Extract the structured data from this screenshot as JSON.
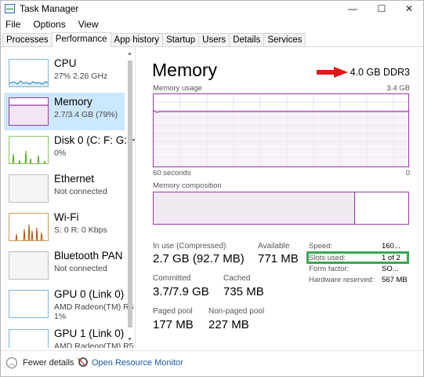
{
  "window": {
    "title": "Task Manager",
    "controls": {
      "minimize": "—",
      "maximize": "☐",
      "close": "✕"
    }
  },
  "menu": [
    "File",
    "Options",
    "View"
  ],
  "tabs": [
    "Processes",
    "Performance",
    "App history",
    "Startup",
    "Users",
    "Details",
    "Services"
  ],
  "active_tab": "Performance",
  "sidebar": {
    "items": [
      {
        "name": "CPU",
        "sub": "27%  2.26 GHz",
        "sub2": "",
        "color": "#117dbb",
        "selected": false
      },
      {
        "name": "Memory",
        "sub": "2.7/3.4 GB (79%)",
        "sub2": "",
        "color": "#8b12ae",
        "selected": true
      },
      {
        "name": "Disk 0 (C: F: G: H",
        "sub": "0%",
        "sub2": "",
        "color": "#4da60c",
        "selected": false
      },
      {
        "name": "Ethernet",
        "sub": "Not connected",
        "sub2": "",
        "color": "#a74f01",
        "selected": false
      },
      {
        "name": "Wi-Fi",
        "sub": "S: 0  R: 0 Kbps",
        "sub2": "",
        "color": "#a74f01",
        "selected": false
      },
      {
        "name": "Bluetooth PAN",
        "sub": "Not connected",
        "sub2": "",
        "color": "#a74f01",
        "selected": false
      },
      {
        "name": "GPU 0 (Link 0)",
        "sub": "AMD Radeon(TM) R5",
        "sub2": "1%",
        "color": "#117dbb",
        "selected": false
      },
      {
        "name": "GPU 1 (Link 0)",
        "sub": "AMD Radeon(TM) R5",
        "sub2": "",
        "color": "#117dbb",
        "selected": false
      }
    ]
  },
  "memory": {
    "title": "Memory",
    "type": "4.0 GB DDR3",
    "usage_label": "Memory usage",
    "usage_max": "3.4 GB",
    "time_left": "60 seconds",
    "time_right": "0",
    "usage_level_fraction": 0.79,
    "composition_label": "Memory composition",
    "composition_used_fraction": 0.79,
    "stats": {
      "in_use_label": "In use (Compressed)",
      "in_use": "2.7 GB (92.7 MB)",
      "available_label": "Available",
      "available": "771 MB",
      "committed_label": "Committed",
      "committed": "3.7/7.9 GB",
      "cached_label": "Cached",
      "cached": "735 MB",
      "paged_label": "Paged pool",
      "paged": "177 MB",
      "nonpaged_label": "Non-paged pool",
      "nonpaged": "227 MB"
    },
    "specs": {
      "speed_label": "Speed:",
      "speed": "160...",
      "slots_label": "Slots used:",
      "slots": "1 of 2",
      "form_label": "Form factor:",
      "form": "SO...",
      "reserved_label": "Hardware reserved:",
      "reserved": "567 MB"
    }
  },
  "footer": {
    "fewer": "Fewer details",
    "monitor": "Open Resource Monitor"
  },
  "colors": {
    "memory_accent": "#9b37a8",
    "highlight_box": "#3aa655",
    "annotation_arrow": "#e01919",
    "selected_bg": "#cce8ff"
  }
}
